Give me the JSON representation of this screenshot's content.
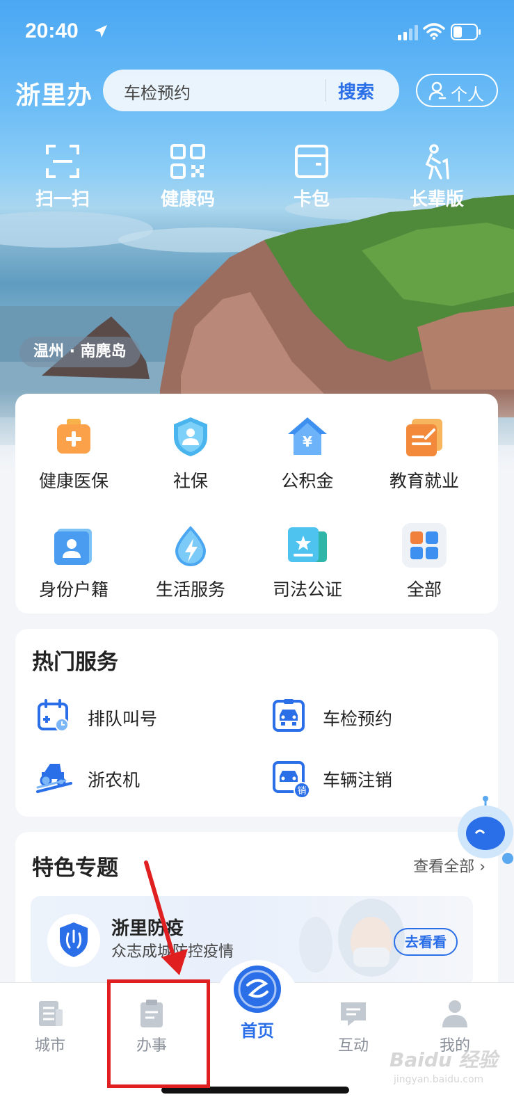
{
  "status_bar": {
    "time": "20:40"
  },
  "header": {
    "brand": "浙里办",
    "search_text": "车检预约",
    "search_button": "搜索",
    "personal_button": "个人"
  },
  "quick_actions": [
    {
      "label": "扫一扫",
      "icon": "scan-icon"
    },
    {
      "label": "健康码",
      "icon": "qr-code-icon"
    },
    {
      "label": "卡包",
      "icon": "card-wallet-icon"
    },
    {
      "label": "长辈版",
      "icon": "elder-icon"
    }
  ],
  "location_tag": "温州 · 南麂岛",
  "services": [
    {
      "label": "健康医保",
      "icon": "medical-kit-icon"
    },
    {
      "label": "社保",
      "icon": "shield-person-icon"
    },
    {
      "label": "公积金",
      "icon": "house-yen-icon"
    },
    {
      "label": "教育就业",
      "icon": "education-icon"
    },
    {
      "label": "身份户籍",
      "icon": "id-card-icon"
    },
    {
      "label": "生活服务",
      "icon": "lightning-drop-icon"
    },
    {
      "label": "司法公证",
      "icon": "notary-icon"
    },
    {
      "label": "全部",
      "icon": "grid-icon"
    }
  ],
  "hot_services": {
    "title": "热门服务",
    "items": [
      {
        "label": "排队叫号",
        "icon": "queue-calendar-icon"
      },
      {
        "label": "车检预约",
        "icon": "car-inspection-icon"
      },
      {
        "label": "浙农机",
        "icon": "tractor-icon"
      },
      {
        "label": "车辆注销",
        "icon": "car-cancel-icon"
      }
    ],
    "cancel_badge": "销"
  },
  "featured": {
    "title": "特色专题",
    "see_all": "查看全部",
    "banner_title": "浙里防疫",
    "banner_subtitle": "众志成城防控疫情",
    "banner_button": "去看看"
  },
  "bottom_nav": [
    {
      "label": "城市",
      "icon": "city-icon"
    },
    {
      "label": "办事",
      "icon": "clipboard-icon"
    },
    {
      "label": "首页",
      "icon": "home-logo-icon"
    },
    {
      "label": "互动",
      "icon": "chat-icon"
    },
    {
      "label": "我的",
      "icon": "person-icon"
    }
  ],
  "watermark": {
    "main": "Baidu 经验",
    "sub": "jingyan.baidu.com"
  },
  "colors": {
    "accent": "#2a6ee8",
    "annotation": "#e02020"
  }
}
